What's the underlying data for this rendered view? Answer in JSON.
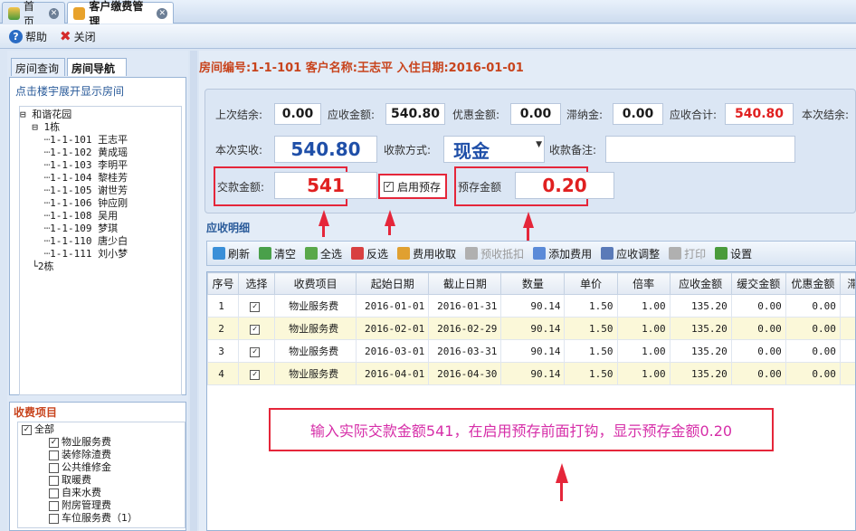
{
  "tabs": [
    {
      "label": "首页"
    },
    {
      "label": "客户缴费管理"
    }
  ],
  "toolbar": {
    "help": "帮助",
    "close": "关闭"
  },
  "left": {
    "tab1": "房间查询",
    "tab2": "房间导航",
    "hint": "点击楼宇展开显示房间",
    "tree": [
      "⊟ 和谐花园",
      "  ⊟ 1栋",
      "    ┈1-1-101 王志平",
      "    ┈1-1-102 黄成瑶",
      "    ┈1-1-103 李明平",
      "    ┈1-1-104 黎桂芳",
      "    ┈1-1-105 谢世芳",
      "    ┈1-1-106 钟应刚",
      "    ┈1-1-108 吴用",
      "    ┈1-1-109 梦琪",
      "    ┈1-1-110 唐少白",
      "    ┈1-1-111 刘小梦",
      "  └2栋"
    ],
    "charge_title": "收费项目",
    "charge_items": [
      {
        "label": "全部",
        "checked": true
      },
      {
        "label": "物业服务费",
        "checked": true
      },
      {
        "label": "装修除渣费",
        "checked": false
      },
      {
        "label": "公共维修金",
        "checked": false
      },
      {
        "label": "取暖费",
        "checked": false
      },
      {
        "label": "自来水费",
        "checked": false
      },
      {
        "label": "附房管理费",
        "checked": false
      },
      {
        "label": "车位服务费（1）",
        "checked": false
      }
    ]
  },
  "info": "房间编号:1-1-101 客户名称:王志平 入住日期:2016-01-01",
  "form": {
    "last_balance_label": "上次结余:",
    "last_balance": "0.00",
    "receivable_label": "应收金额:",
    "receivable": "540.80",
    "discount_label": "优惠金额:",
    "discount": "0.00",
    "late_fee_label": "滞纳金:",
    "late_fee": "0.00",
    "total_label": "应收合计:",
    "total": "540.80",
    "this_balance_label": "本次结余:",
    "actual_label": "本次实收:",
    "actual": "540.80",
    "method_label": "收款方式:",
    "method": "现金",
    "remark_label": "收款备注:",
    "paid_label": "交款金额:",
    "paid": "541",
    "prepay_check_label": "启用预存",
    "prepay_label": "预存金额",
    "prepay": "0.20"
  },
  "grid": {
    "section": "应收明细",
    "toolbar": [
      "刷新",
      "清空",
      "全选",
      "反选",
      "费用收取",
      "预收抵扣",
      "添加费用",
      "应收调整",
      "打印",
      "设置"
    ],
    "headers": [
      "序号",
      "选择",
      "收费项目",
      "起始日期",
      "截止日期",
      "数量",
      "单价",
      "倍率",
      "应收金额",
      "缓交金额",
      "优惠金额",
      "滞纳"
    ],
    "rows": [
      [
        "1",
        "物业服务费",
        "2016-01-01",
        "2016-01-31",
        "90.14",
        "1.50",
        "1.00",
        "135.20",
        "0.00",
        "0.00"
      ],
      [
        "2",
        "物业服务费",
        "2016-02-01",
        "2016-02-29",
        "90.14",
        "1.50",
        "1.00",
        "135.20",
        "0.00",
        "0.00"
      ],
      [
        "3",
        "物业服务费",
        "2016-03-01",
        "2016-03-31",
        "90.14",
        "1.50",
        "1.00",
        "135.20",
        "0.00",
        "0.00"
      ],
      [
        "4",
        "物业服务费",
        "2016-04-01",
        "2016-04-30",
        "90.14",
        "1.50",
        "1.00",
        "135.20",
        "0.00",
        "0.00"
      ]
    ]
  },
  "annotation": "输入实际交款金额541，在启用预存前面打钩，显示预存金额0.20",
  "colors": {
    "accent": "#c8441d",
    "red": "#e5263a",
    "annotation": "#d62ea8"
  }
}
